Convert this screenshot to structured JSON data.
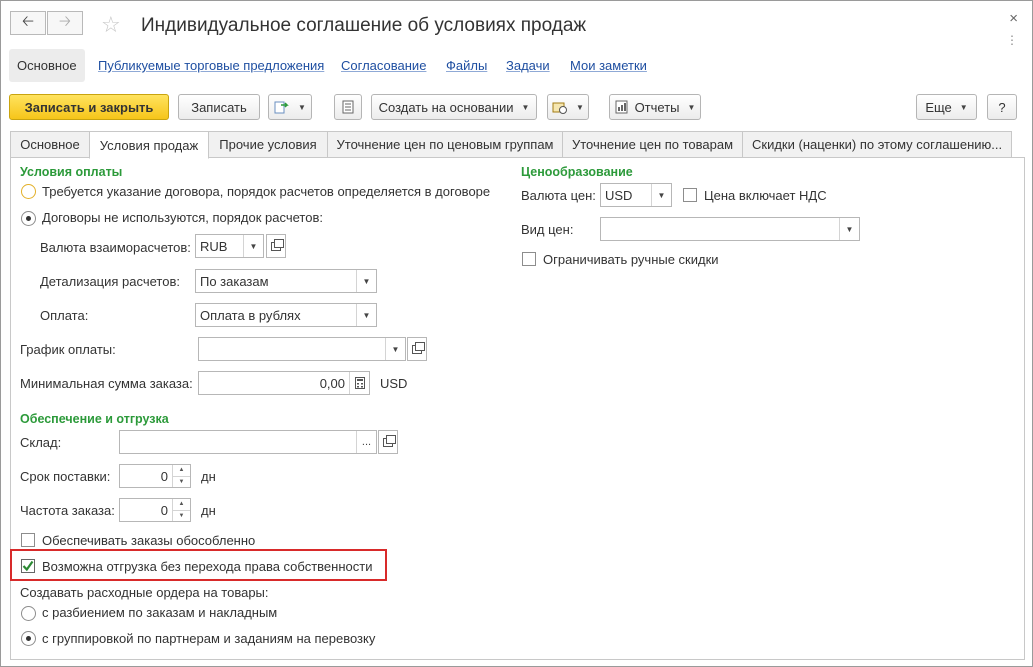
{
  "window": {
    "title": "Индивидуальное соглашение об условиях продаж",
    "back_icon": "arrow-left-icon",
    "forward_icon": "arrow-right-icon",
    "favorite_icon": "star-icon",
    "close_symbol": "×",
    "more_symbol": "⋮"
  },
  "nav": {
    "items": [
      {
        "label": "Основное",
        "active": true
      },
      {
        "label": "Публикуемые торговые предложения"
      },
      {
        "label": "Согласование"
      },
      {
        "label": "Файлы"
      },
      {
        "label": "Задачи"
      },
      {
        "label": "Мои заметки"
      }
    ]
  },
  "toolbar": {
    "save_close": "Записать и закрыть",
    "save": "Записать",
    "create_based": "Создать на основании",
    "reports": "Отчеты",
    "more": "Еще",
    "help": "?"
  },
  "tabs": [
    {
      "label": "Основное"
    },
    {
      "label": "Условия продаж",
      "active": true
    },
    {
      "label": "Прочие условия"
    },
    {
      "label": "Уточнение цен по ценовым группам"
    },
    {
      "label": "Уточнение цен по товарам"
    },
    {
      "label": "Скидки (наценки) по этому соглашению..."
    }
  ],
  "payment": {
    "header": "Условия оплаты",
    "radio_contract": "Требуется указание договора, порядок расчетов определяется в договоре",
    "radio_no_contract": "Договоры не используются, порядок расчетов:",
    "currency_label": "Валюта взаиморасчетов:",
    "currency_value": "RUB",
    "detail_label": "Детализация расчетов:",
    "detail_value": "По заказам",
    "payment_label": "Оплата:",
    "payment_value": "Оплата в рублях",
    "schedule_label": "График оплаты:",
    "schedule_value": "",
    "min_sum_label": "Минимальная сумма заказа:",
    "min_sum_value": "0,00",
    "min_sum_currency": "USD"
  },
  "pricing": {
    "header": "Ценообразование",
    "currency_label": "Валюта цен:",
    "currency_value": "USD",
    "vat_label": "Цена включает НДС",
    "vat_checked": false,
    "price_type_label": "Вид цен:",
    "price_type_value": "",
    "limit_discounts_label": "Ограничивать ручные скидки",
    "limit_discounts_checked": false
  },
  "shipping": {
    "header": "Обеспечение и отгрузка",
    "warehouse_label": "Склад:",
    "warehouse_value": "",
    "lead_time_label": "Срок поставки:",
    "lead_time_value": "0",
    "lead_time_unit": "дн",
    "frequency_label": "Частота заказа:",
    "frequency_value": "0",
    "frequency_unit": "дн",
    "separate_label": "Обеспечивать заказы обособленно",
    "separate_checked": false,
    "ownership_label": "Возможна отгрузка без перехода права собственности",
    "ownership_checked": true,
    "orders_label": "Создавать расходные ордера на товары:",
    "orders_option1": "с разбиением по заказам и накладным",
    "orders_option2": "с группировкой по партнерам и заданиям на перевозку",
    "orders_selected": 2
  }
}
